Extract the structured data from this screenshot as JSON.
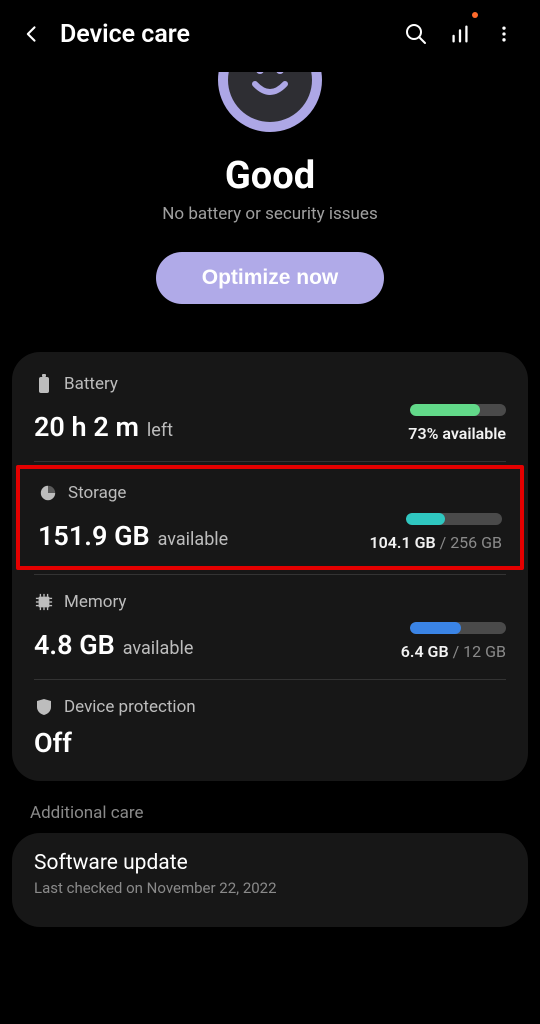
{
  "header": {
    "title": "Device care"
  },
  "hero": {
    "status_title": "Good",
    "status_subtitle": "No battery or security issues",
    "optimize_label": "Optimize now"
  },
  "battery": {
    "label": "Battery",
    "value": "20 h 2 m",
    "suffix": "left",
    "available_text": "73% available",
    "fill_percent": 73,
    "fill_color": "#62d989"
  },
  "storage": {
    "label": "Storage",
    "value": "151.9 GB",
    "suffix": "available",
    "used_text": "104.1 GB",
    "total_text": "256 GB",
    "fill_percent": 41,
    "fill_color": "#2fc7c0"
  },
  "memory": {
    "label": "Memory",
    "value": "4.8 GB",
    "suffix": "available",
    "used_text": "6.4 GB",
    "total_text": "12 GB",
    "fill_percent": 53,
    "fill_color": "#3a84e6"
  },
  "protection": {
    "label": "Device protection",
    "value": "Off"
  },
  "additional": {
    "section_label": "Additional care",
    "software_update_title": "Software update",
    "software_update_sub": "Last checked on November 22, 2022"
  }
}
